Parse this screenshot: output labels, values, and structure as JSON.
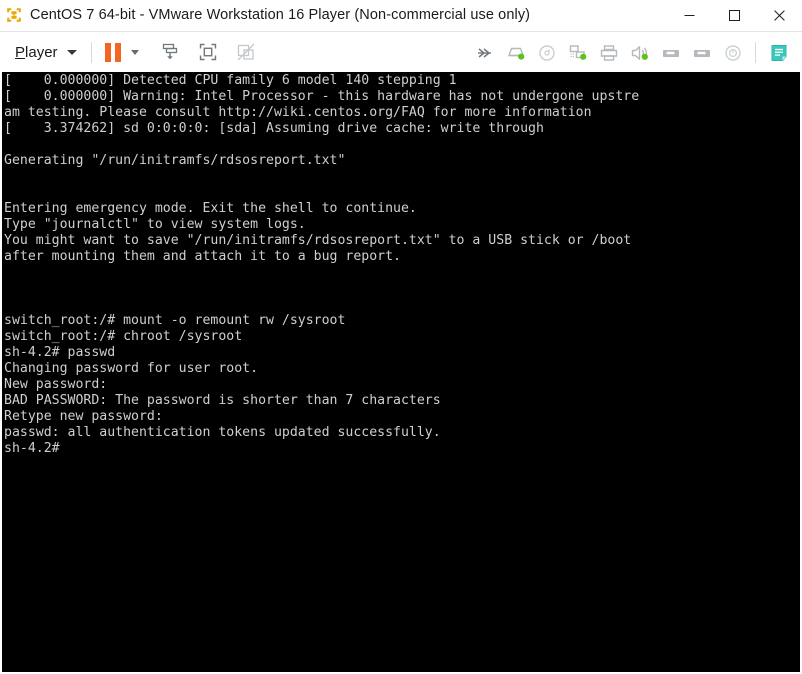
{
  "window": {
    "title": "CentOS 7 64-bit - VMware Workstation 16 Player (Non-commercial use only)",
    "logo_icon": "vmware-logo-icon",
    "controls": {
      "minimize_label": "─",
      "minimize_icon": "minimize-icon",
      "maximize_label": "☐",
      "maximize_icon": "maximize-icon",
      "close_label": "✕",
      "close_icon": "close-icon"
    }
  },
  "toolbar": {
    "player_menu_label": "Player",
    "player_menu_accesskey": "P",
    "dropdown_icon": "chevron-down-icon",
    "buttons": [
      {
        "name": "pause-button",
        "icon": "pause-icon",
        "label": "Pause",
        "color": "#f26522"
      },
      {
        "name": "pause-dropdown-button",
        "icon": "chevron-down-icon",
        "label": "Pause options"
      },
      {
        "name": "send-key-button",
        "icon": "send-ctrl-alt-del-icon",
        "label": "Send Ctrl+Alt+Del"
      },
      {
        "name": "full-screen-button",
        "icon": "full-screen-icon",
        "label": "Enter full screen mode"
      },
      {
        "name": "unity-mode-button",
        "icon": "unity-mode-disabled-icon",
        "label": "Unity mode (disabled)"
      }
    ],
    "devices": [
      {
        "name": "expand-devices-button",
        "icon": "chevrons-right-icon",
        "label": "More devices",
        "connected": false
      },
      {
        "name": "hard-disk-device",
        "icon": "hard-disk-icon",
        "label": "Hard Disk (SCSI)",
        "connected": true
      },
      {
        "name": "cd-dvd-device",
        "icon": "cd-dvd-icon",
        "label": "CD/DVD (IDE)",
        "connected": false
      },
      {
        "name": "network-adapter-device",
        "icon": "network-adapter-icon",
        "label": "Network Adapter",
        "connected": true
      },
      {
        "name": "printer-device",
        "icon": "printer-icon",
        "label": "Printer",
        "connected": false
      },
      {
        "name": "sound-card-device",
        "icon": "sound-card-icon",
        "label": "Sound Card",
        "connected": true
      },
      {
        "name": "usb-device-1",
        "icon": "usb-icon",
        "label": "USB Device 1",
        "connected": false
      },
      {
        "name": "usb-device-2",
        "icon": "usb-icon",
        "label": "USB Device 2",
        "connected": false
      },
      {
        "name": "camera-device",
        "icon": "camera-icon",
        "label": "Camera",
        "connected": false
      }
    ],
    "message_log_button": {
      "name": "message-log-button",
      "icon": "message-log-icon",
      "label": "Message log",
      "color": "#39c9bb"
    },
    "colors": {
      "accent_orange": "#f26522",
      "connected_green": "#5fc21a",
      "device_gray": "#b3b9bd",
      "message_teal": "#39c9bb"
    }
  },
  "console": {
    "foreground": "#cfcfcf",
    "background": "#000000",
    "lines": [
      "[    0.000000] Detected CPU family 6 model 140 stepping 1",
      "[    0.000000] Warning: Intel Processor - this hardware has not undergone upstre",
      "am testing. Please consult http://wiki.centos.org/FAQ for more information",
      "[    3.374262] sd 0:0:0:0: [sda] Assuming drive cache: write through",
      "",
      "Generating \"/run/initramfs/rdsosreport.txt\"",
      "",
      "",
      "Entering emergency mode. Exit the shell to continue.",
      "Type \"journalctl\" to view system logs.",
      "You might want to save \"/run/initramfs/rdsosreport.txt\" to a USB stick or /boot",
      "after mounting them and attach it to a bug report.",
      "",
      "",
      "",
      "switch_root:/# mount -o remount rw /sysroot",
      "switch_root:/# chroot /sysroot",
      "sh-4.2# passwd",
      "Changing password for user root.",
      "New password:",
      "BAD PASSWORD: The password is shorter than 7 characters",
      "Retype new password:",
      "passwd: all authentication tokens updated successfully.",
      "sh-4.2#"
    ]
  }
}
